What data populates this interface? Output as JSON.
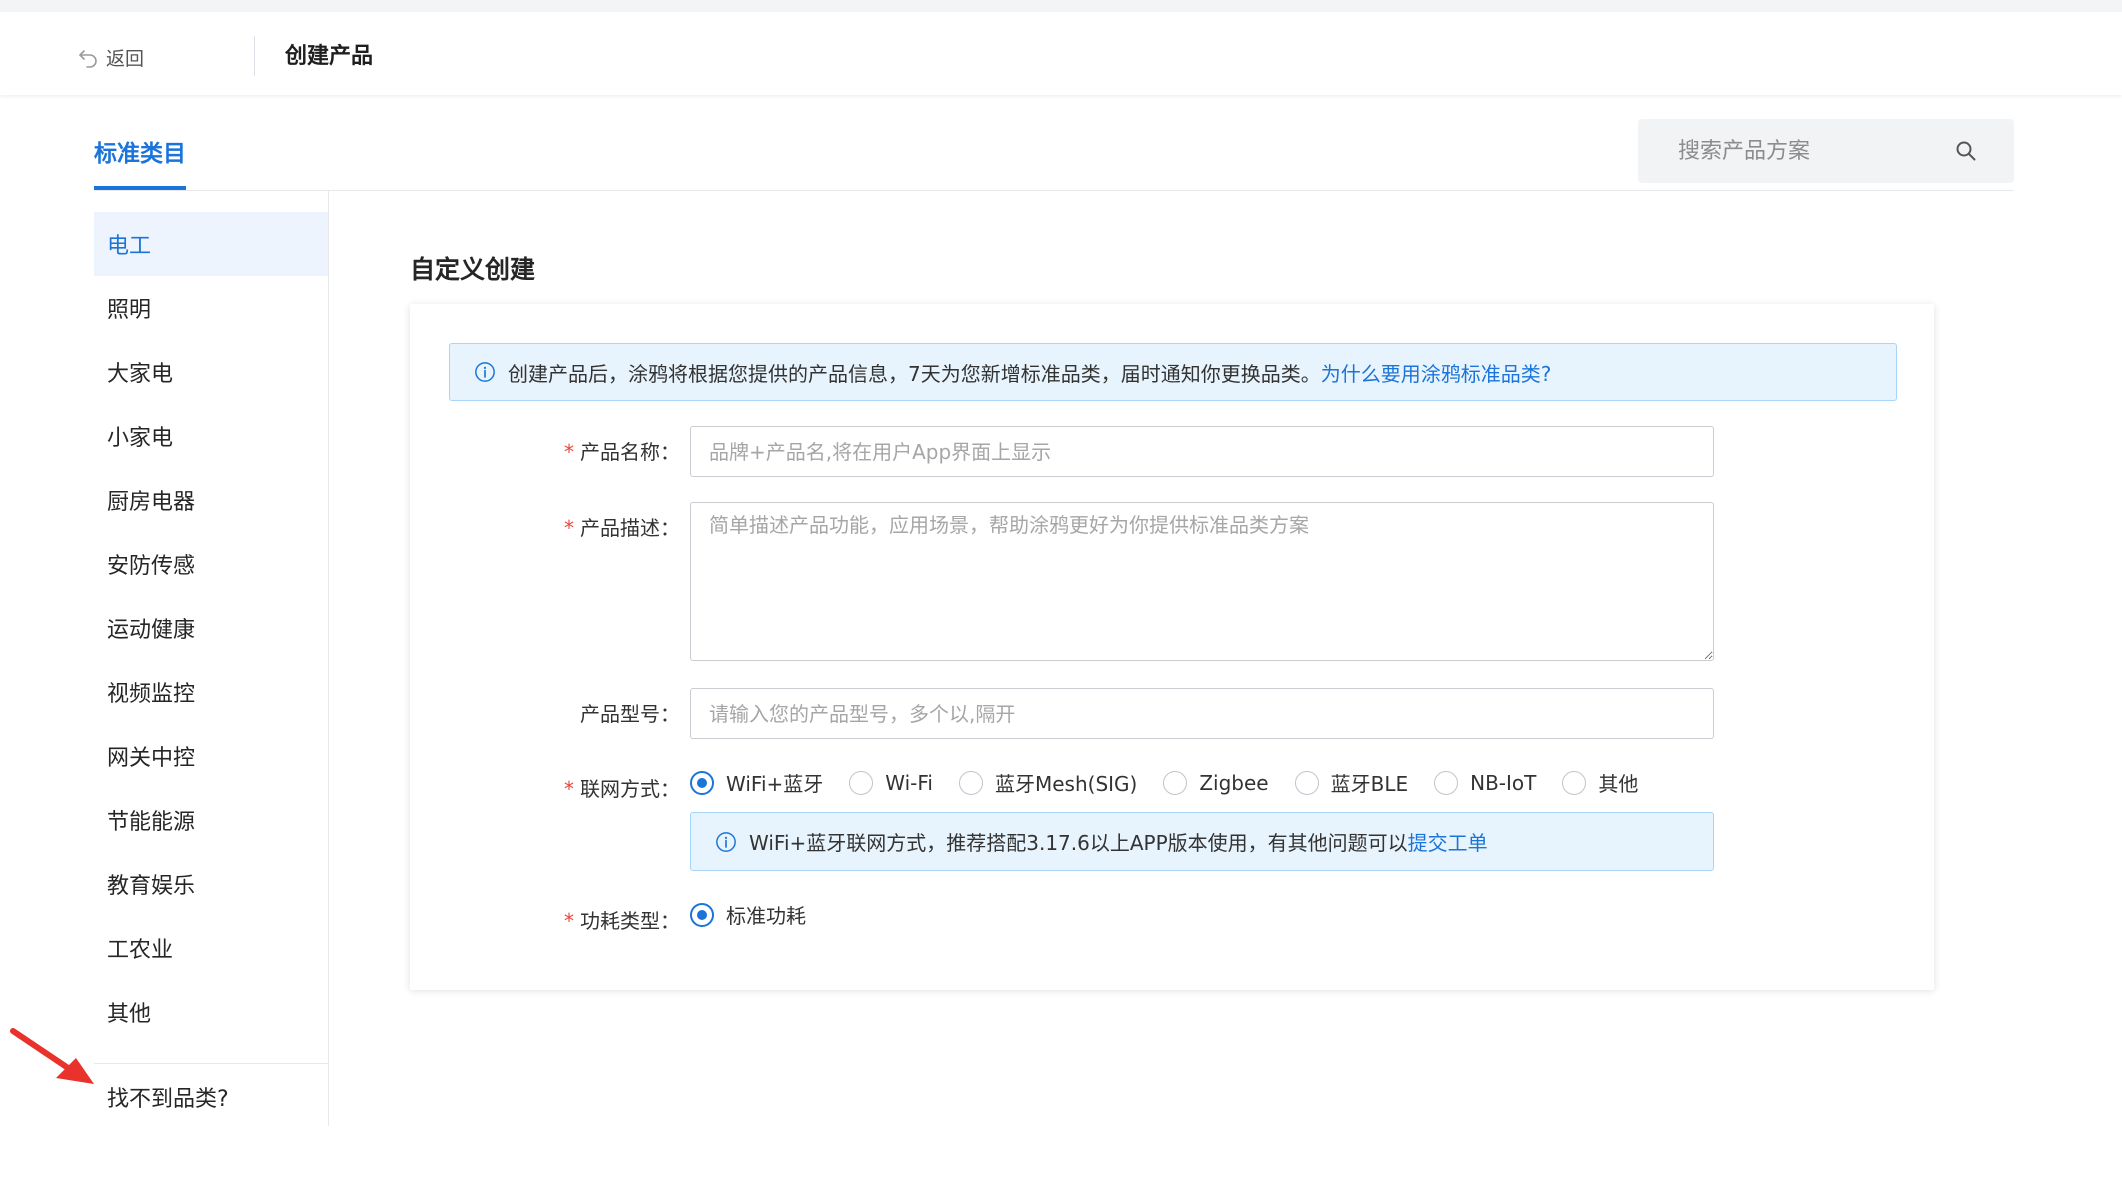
{
  "header": {
    "back_label": "返回",
    "title": "创建产品"
  },
  "tabs": [
    {
      "label": "标准类目"
    }
  ],
  "search": {
    "placeholder": "搜索产品方案"
  },
  "sidebar": {
    "items": [
      {
        "label": "电工"
      },
      {
        "label": "照明"
      },
      {
        "label": "大家电"
      },
      {
        "label": "小家电"
      },
      {
        "label": "厨房电器"
      },
      {
        "label": "安防传感"
      },
      {
        "label": "运动健康"
      },
      {
        "label": "视频监控"
      },
      {
        "label": "网关中控"
      },
      {
        "label": "节能能源"
      },
      {
        "label": "教育娱乐"
      },
      {
        "label": "工农业"
      },
      {
        "label": "其他"
      }
    ],
    "help_link": "找不到品类?"
  },
  "main": {
    "section_title": "自定义创建",
    "alert": {
      "text": "创建产品后，涂鸦将根据您提供的产品信息，7天为您新增标准品类，届时通知你更换品类。",
      "link": "为什么要用涂鸦标准品类?"
    },
    "form": {
      "name": {
        "required_mark": "*",
        "label": "产品名称：",
        "placeholder": "品牌+产品名,将在用户App界面上显示",
        "value": ""
      },
      "description": {
        "required_mark": "*",
        "label": "产品描述：",
        "placeholder": "简单描述产品功能，应用场景，帮助涂鸦更好为你提供标准品类方案",
        "value": ""
      },
      "model": {
        "label": "产品型号：",
        "placeholder": "请输入您的产品型号，多个以,隔开",
        "value": ""
      },
      "network": {
        "required_mark": "*",
        "label": "联网方式：",
        "selected": "WiFi+蓝牙",
        "options": [
          {
            "label": "WiFi+蓝牙"
          },
          {
            "label": "Wi-Fi"
          },
          {
            "label": "蓝牙Mesh(SIG)"
          },
          {
            "label": "Zigbee"
          },
          {
            "label": "蓝牙BLE"
          },
          {
            "label": "NB-IoT"
          },
          {
            "label": "其他"
          }
        ],
        "hint": {
          "text": "WiFi+蓝牙联网方式，推荐搭配3.17.6以上APP版本使用，有其他问题可以",
          "link": "提交工单"
        }
      },
      "power": {
        "required_mark": "*",
        "label": "功耗类型：",
        "selected": "标准功耗",
        "options": [
          {
            "label": "标准功耗"
          }
        ]
      }
    }
  },
  "colors": {
    "accent": "#1b74d9",
    "required": "#e8473b",
    "annotation_arrow": "#e8322b"
  }
}
